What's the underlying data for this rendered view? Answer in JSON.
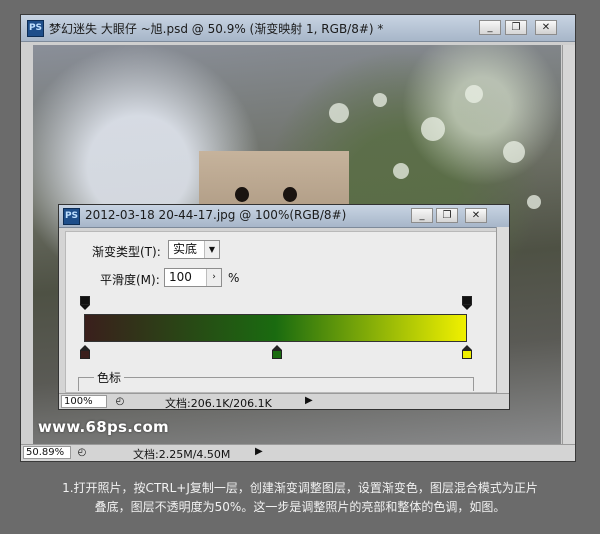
{
  "outer_window": {
    "app_icon": "PS",
    "title": "梦幻迷失 大眼仔 ~旭.psd @ 50.9% (渐变映射 1, RGB/8#) *",
    "minimize_glyph": "_",
    "restore_glyph": "❐",
    "close_glyph": "✕",
    "zoom_level": "50.89%",
    "doc_info": "文档:2.25M/4.50M"
  },
  "inner_window": {
    "app_icon": "PS",
    "title": "2012-03-18 20-44-17.jpg @ 100%(RGB/8#)",
    "minimize_glyph": "_",
    "restore_glyph": "❐",
    "close_glyph": "✕",
    "gradient_type_label": "渐变类型(T):",
    "gradient_type_value": "实底",
    "smoothness_label": "平滑度(M):",
    "smoothness_value": "100",
    "smoothness_unit": "%",
    "color_stops_label": "色标",
    "zoom_level": "100%",
    "doc_info": "文档:206.1K/206.1K"
  },
  "gradient": {
    "colors": [
      "#3a1f1c",
      "#1a6b10",
      "#f0f000"
    ]
  },
  "watermark": "www.68ps.com",
  "caption": {
    "line1": "1.打开照片，按CTRL+J复制一层，创建渐变调整图层，设置渐变色，图层混合模式为正片",
    "line2": "叠底，图层不透明度为50%。这一步是调整照片的亮部和整体的色调，如图。"
  },
  "icons": {
    "ps_icon": "ps-icon",
    "dropdown": "chevron-down-icon",
    "stepper": "chevron-right-icon",
    "nav_right": "triangle-right-icon",
    "status_menu": "status-menu-icon"
  }
}
